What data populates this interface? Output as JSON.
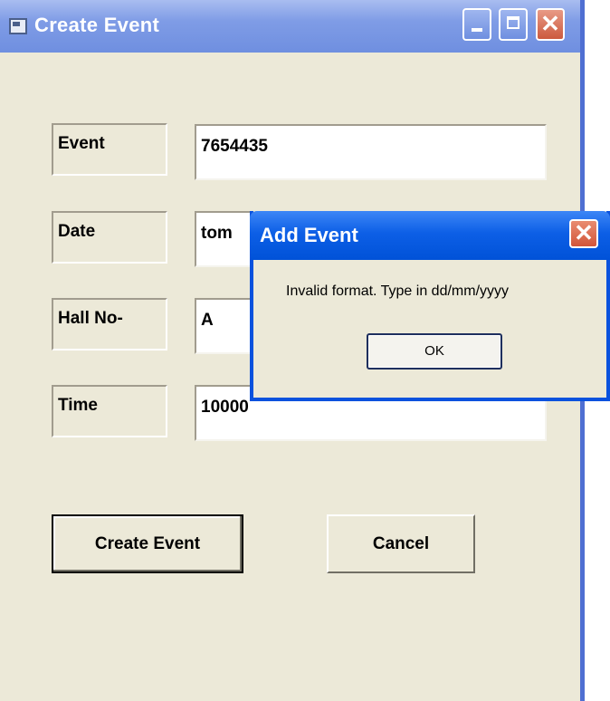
{
  "window": {
    "title": "Create Event"
  },
  "form": {
    "fields": [
      {
        "label": "Event",
        "value": "7654435"
      },
      {
        "label": "Date",
        "value": "tom"
      },
      {
        "label": "Hall No-",
        "value": "A"
      },
      {
        "label": "Time",
        "value": "10000"
      }
    ],
    "create_button_label": "Create Event",
    "cancel_button_label": "Cancel"
  },
  "dialog": {
    "title": "Add Event",
    "message": "Invalid format. Type in dd/mm/yyyy",
    "ok_label": "OK",
    "close_glyph": "✕"
  },
  "titlebar_buttons": {
    "close_glyph": "✕"
  },
  "icons": [
    "app-window-icon",
    "minimize-icon",
    "maximize-icon",
    "close-icon"
  ],
  "colors": {
    "window_face": "#ece9d8",
    "dialog_titlebar": "#0052d8",
    "main_titlebar": "#7f9ce6",
    "close_red": "#d2553a"
  }
}
